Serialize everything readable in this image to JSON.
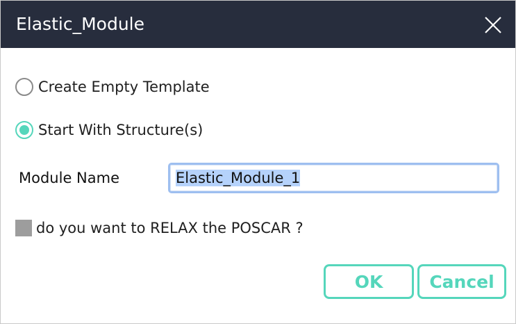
{
  "window": {
    "title": "Elastic_Module",
    "close_icon": "close-icon"
  },
  "options": {
    "create_empty_label": "Create Empty Template",
    "start_with_structure_label": "Start With Structure(s)",
    "selected": "start_with_structure"
  },
  "module_name": {
    "label": "Module Name",
    "value": "Elastic_Module_1"
  },
  "relax": {
    "label": "do you want to RELAX the POSCAR ?",
    "checked": false
  },
  "buttons": {
    "ok_label": "OK",
    "cancel_label": "Cancel"
  },
  "colors": {
    "titlebar": "#272d3d",
    "accent": "#55d6bb",
    "input_focus": "#9ebff0",
    "checkbox": "#9d9d9d"
  }
}
